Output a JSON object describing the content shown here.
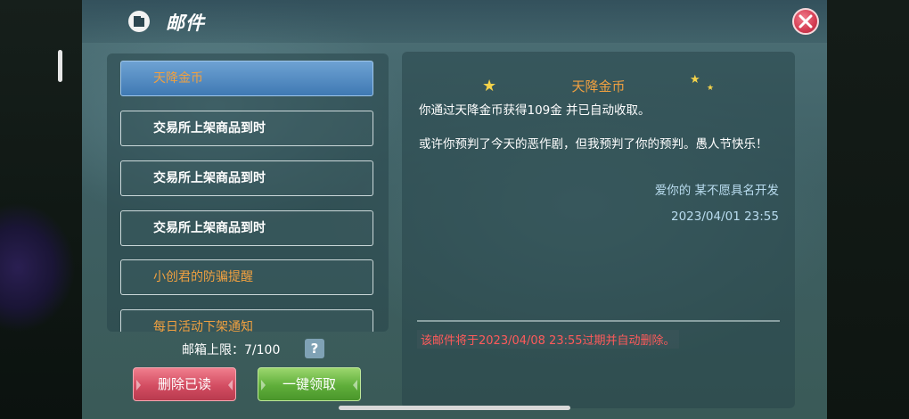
{
  "window": {
    "title": "邮件"
  },
  "mail_list": [
    {
      "label": "天降金币",
      "selected": true,
      "style": "orange"
    },
    {
      "label": "交易所上架商品到时",
      "selected": false,
      "style": "white"
    },
    {
      "label": "交易所上架商品到时",
      "selected": false,
      "style": "white"
    },
    {
      "label": "交易所上架商品到时",
      "selected": false,
      "style": "white"
    },
    {
      "label": "小创君的防骗提醒",
      "selected": false,
      "style": "orange"
    },
    {
      "label": "每日活动下架通知",
      "selected": false,
      "style": "orange"
    }
  ],
  "capacity": {
    "label": "邮箱上限：",
    "value": "7/100"
  },
  "help_symbol": "?",
  "buttons": {
    "delete_read": "删除已读",
    "collect_all": "一键领取"
  },
  "detail": {
    "title": "天降金币",
    "line1": "你通过天降金币获得109金 并已自动收取。",
    "line2": "或许你预判了今天的恶作剧，但我预判了你的预判。愚人节快乐！",
    "signature": "爱你的 某不愿具名开发",
    "date": "2023/04/01 23:55",
    "expire_notice": "该邮件将于2023/04/08 23:55过期并自动删除。"
  },
  "colors": {
    "accent_orange": "#f0a040",
    "warning_red": "#ff5a5a",
    "signature_blue": "#b9dcef"
  },
  "icons": [
    "mail-icon",
    "close-icon",
    "help-icon",
    "star-icon"
  ]
}
